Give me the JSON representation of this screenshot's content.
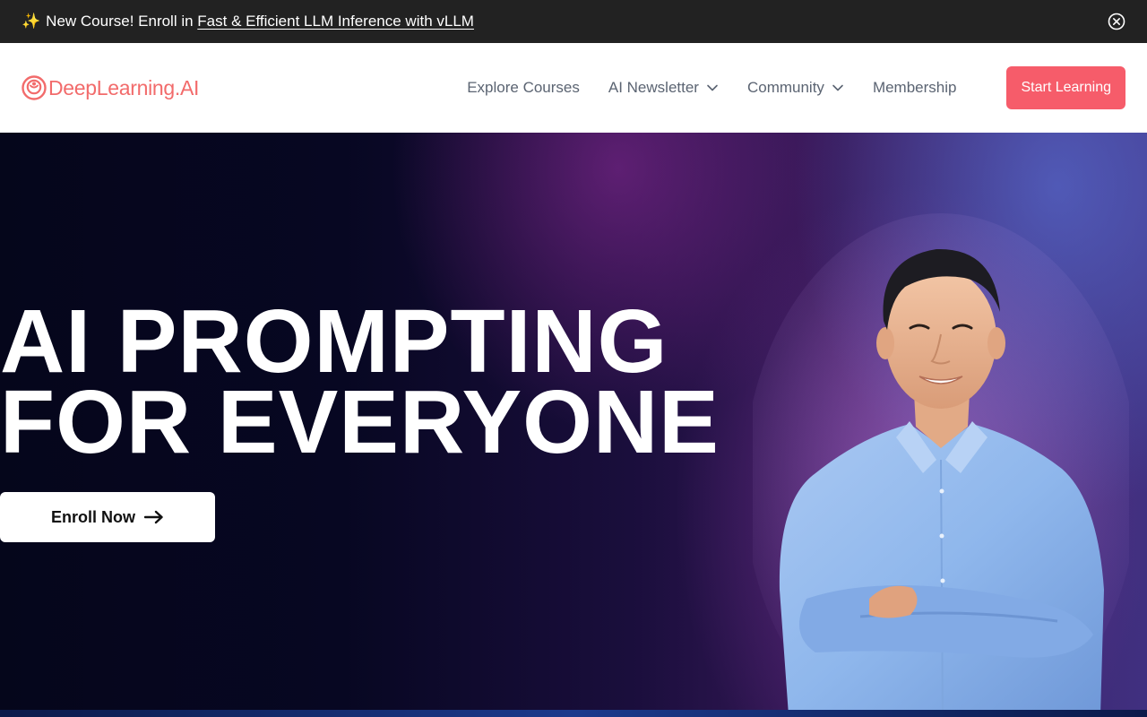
{
  "announcement": {
    "sparkle": "✨",
    "prefix": "New Course! Enroll in ",
    "link_text": "Fast & Efficient LLM Inference with vLLM"
  },
  "header": {
    "logo_text": "DeepLearning.AI",
    "nav": [
      {
        "label": "Explore Courses",
        "has_dropdown": false
      },
      {
        "label": "AI Newsletter",
        "has_dropdown": true
      },
      {
        "label": "Community",
        "has_dropdown": true
      },
      {
        "label": "Membership",
        "has_dropdown": false
      }
    ],
    "cta_label": "Start Learning"
  },
  "hero": {
    "title_line1": "AI PROMPTING",
    "title_line2": "FOR EVERYONE",
    "enroll_label": "Enroll Now"
  },
  "colors": {
    "brand": "#f26b6b",
    "cta": "#f65c6a",
    "announcement_bg": "#222222",
    "nav_text": "#5b6472",
    "hero_dark": "#05061b",
    "hero_purple": "#3a1a5c",
    "shirt": "#8fb7ec"
  },
  "icons": {
    "announcement_close": "close-circle-icon",
    "logo": "deeplearning-logo-icon",
    "nav_dropdown": "chevron-down-icon",
    "enroll_arrow": "arrow-right-icon"
  }
}
